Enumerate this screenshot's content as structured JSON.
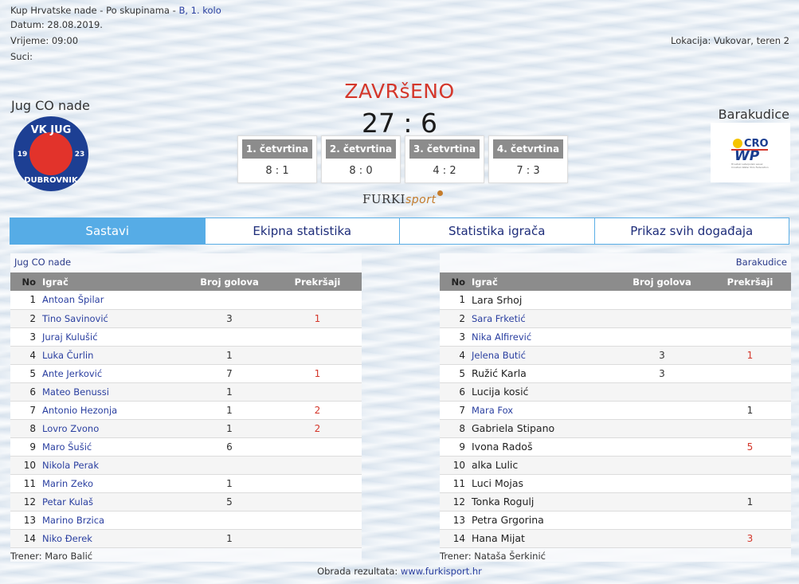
{
  "meta": {
    "competition": "Kup Hrvatske nade - Po skupinama - ",
    "round_link": "B, 1. kolo",
    "date": "Datum: 28.08.2019.",
    "time": "Vrijeme: 09:00",
    "referees": "Suci:",
    "location": "Lokacija: Vukovar, teren 2"
  },
  "match": {
    "status": "ZAVRšENO",
    "score": "27 : 6",
    "home_team": "Jug CO nade",
    "away_team": "Barakudice",
    "home_logo_text_top": "VK JUG",
    "home_logo_text_left": "19",
    "home_logo_text_right": "23",
    "home_logo_text_bottom": "DUBROVNIK",
    "away_logo_text": "CRO",
    "away_logo_wp": "WP",
    "away_logo_caption": "Hrvatski vaterpolski savez Croatian Water Polo Federation",
    "quarters": [
      {
        "label": "1. četvrtina",
        "score": "8 : 1"
      },
      {
        "label": "2. četvrtina",
        "score": "8 : 0"
      },
      {
        "label": "3. četvrtina",
        "score": "4 : 2"
      },
      {
        "label": "4. četvrtina",
        "score": "7 : 3"
      }
    ]
  },
  "brand": {
    "furki": "FURKI",
    "sport": "sport"
  },
  "tabs": [
    "Sastavi",
    "Ekipna statistika",
    "Statistika igrača",
    "Prikaz svih događaja"
  ],
  "columns": {
    "no": "No",
    "player": "Igrač",
    "goals": "Broj golova",
    "fouls": "Prekršaji"
  },
  "home": {
    "title": "Jug CO nade",
    "coach": "Trener: Maro Balić",
    "players": [
      {
        "no": "1",
        "name": "Antoan Špilar",
        "goals": "",
        "fouls": ""
      },
      {
        "no": "2",
        "name": "Tino Savinović",
        "goals": "3",
        "fouls": "1"
      },
      {
        "no": "3",
        "name": "Juraj Kulušić",
        "goals": "",
        "fouls": ""
      },
      {
        "no": "4",
        "name": "Luka Čurlin",
        "goals": "1",
        "fouls": ""
      },
      {
        "no": "5",
        "name": "Ante Jerković",
        "goals": "7",
        "fouls": "1"
      },
      {
        "no": "6",
        "name": "Mateo Benussi",
        "goals": "1",
        "fouls": ""
      },
      {
        "no": "7",
        "name": "Antonio Hezonja",
        "goals": "1",
        "fouls": "2"
      },
      {
        "no": "8",
        "name": "Lovro Zvono",
        "goals": "1",
        "fouls": "2"
      },
      {
        "no": "9",
        "name": "Maro Šušić",
        "goals": "6",
        "fouls": ""
      },
      {
        "no": "10",
        "name": "Nikola Perak",
        "goals": "",
        "fouls": ""
      },
      {
        "no": "11",
        "name": "Marin Zeko",
        "goals": "1",
        "fouls": ""
      },
      {
        "no": "12",
        "name": "Petar Kulaš",
        "goals": "5",
        "fouls": ""
      },
      {
        "no": "13",
        "name": "Marino Brzica",
        "goals": "",
        "fouls": ""
      },
      {
        "no": "14",
        "name": "Niko Đerek",
        "goals": "1",
        "fouls": ""
      }
    ]
  },
  "away": {
    "title": "Barakudice",
    "coach": "Trener: Nataša Šerkinić",
    "players": [
      {
        "no": "1",
        "name": "Lara Srhoj",
        "goals": "",
        "fouls": "",
        "link": false
      },
      {
        "no": "2",
        "name": "Sara Frketić",
        "goals": "",
        "fouls": "",
        "link": true
      },
      {
        "no": "3",
        "name": "Nika Alfirević",
        "goals": "",
        "fouls": "",
        "link": true
      },
      {
        "no": "4",
        "name": "Jelena Butić",
        "goals": "3",
        "fouls": "1",
        "link": true,
        "red": true
      },
      {
        "no": "5",
        "name": "Ružić Karla",
        "goals": "3",
        "fouls": "",
        "link": false
      },
      {
        "no": "6",
        "name": "Lucija kosić",
        "goals": "",
        "fouls": "",
        "link": false
      },
      {
        "no": "7",
        "name": "Mara Fox",
        "goals": "",
        "fouls": "1",
        "link": true,
        "red": false
      },
      {
        "no": "8",
        "name": "Gabriela Stipano",
        "goals": "",
        "fouls": "",
        "link": false
      },
      {
        "no": "9",
        "name": "Ivona Radoš",
        "goals": "",
        "fouls": "5",
        "link": false,
        "red": true
      },
      {
        "no": "10",
        "name": "alka Lulic",
        "goals": "",
        "fouls": "",
        "link": false
      },
      {
        "no": "11",
        "name": "Luci Mojas",
        "goals": "",
        "fouls": "",
        "link": false
      },
      {
        "no": "12",
        "name": "Tonka Rogulj",
        "goals": "",
        "fouls": "1",
        "link": false,
        "red": false
      },
      {
        "no": "13",
        "name": "Petra Grgorina",
        "goals": "",
        "fouls": "",
        "link": false
      },
      {
        "no": "14",
        "name": "Hana Mijat",
        "goals": "",
        "fouls": "3",
        "link": false,
        "red": true
      }
    ]
  },
  "footer": {
    "label": "Obrada rezultata: ",
    "link": "www.furkisport.hr"
  },
  "colors": {
    "accent": "#56ace6",
    "link": "#2a3fa0",
    "red": "#d4372b",
    "header": "#8c8c8c"
  }
}
